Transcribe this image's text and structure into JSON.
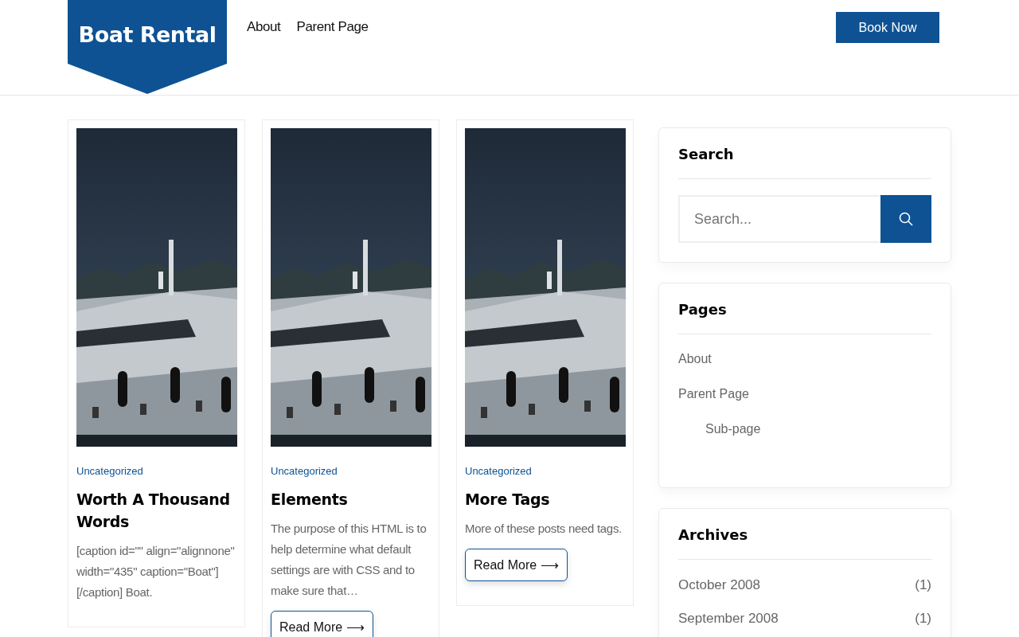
{
  "header": {
    "logo": "Boat Rental",
    "nav": [
      "About",
      "Parent Page"
    ],
    "cta": "Book Now"
  },
  "posts": [
    {
      "category": "Uncategorized",
      "title": "Worth A Thousand Words",
      "excerpt": "[caption id=\"\" align=\"alignnone\" width=\"435\" caption=\"Boat\"] [/caption] Boat."
    },
    {
      "category": "Uncategorized",
      "title": "Elements",
      "excerpt": "The purpose of this HTML is to help determine what default settings are with CSS and to make sure that…",
      "button": "Read More ⟶"
    },
    {
      "category": "Uncategorized",
      "title": "More Tags",
      "excerpt": "More of these posts need tags.",
      "button": "Read More ⟶"
    }
  ],
  "sidebar": {
    "search": {
      "title": "Search",
      "placeholder": "Search..."
    },
    "pages": {
      "title": "Pages",
      "items": [
        {
          "label": "About"
        },
        {
          "label": "Parent Page",
          "children": [
            {
              "label": "Sub-page"
            }
          ]
        }
      ]
    },
    "archives": {
      "title": "Archives",
      "items": [
        {
          "label": "October 2008",
          "count": "(1)"
        },
        {
          "label": "September 2008",
          "count": "(1)"
        }
      ]
    }
  }
}
